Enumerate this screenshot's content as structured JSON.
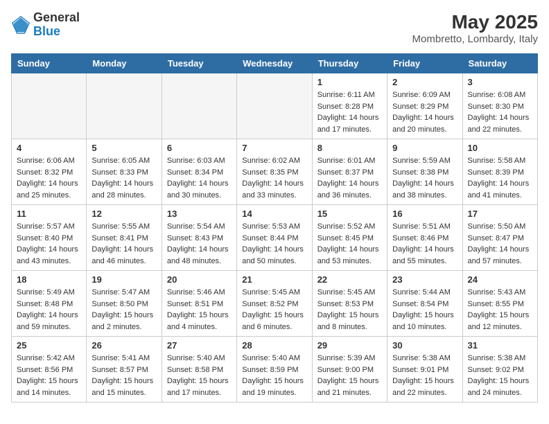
{
  "header": {
    "logo_general": "General",
    "logo_blue": "Blue",
    "month_year": "May 2025",
    "location": "Mombretto, Lombardy, Italy"
  },
  "days_of_week": [
    "Sunday",
    "Monday",
    "Tuesday",
    "Wednesday",
    "Thursday",
    "Friday",
    "Saturday"
  ],
  "weeks": [
    [
      {
        "day": "",
        "info": ""
      },
      {
        "day": "",
        "info": ""
      },
      {
        "day": "",
        "info": ""
      },
      {
        "day": "",
        "info": ""
      },
      {
        "day": "1",
        "info": "Sunrise: 6:11 AM\nSunset: 8:28 PM\nDaylight: 14 hours\nand 17 minutes."
      },
      {
        "day": "2",
        "info": "Sunrise: 6:09 AM\nSunset: 8:29 PM\nDaylight: 14 hours\nand 20 minutes."
      },
      {
        "day": "3",
        "info": "Sunrise: 6:08 AM\nSunset: 8:30 PM\nDaylight: 14 hours\nand 22 minutes."
      }
    ],
    [
      {
        "day": "4",
        "info": "Sunrise: 6:06 AM\nSunset: 8:32 PM\nDaylight: 14 hours\nand 25 minutes."
      },
      {
        "day": "5",
        "info": "Sunrise: 6:05 AM\nSunset: 8:33 PM\nDaylight: 14 hours\nand 28 minutes."
      },
      {
        "day": "6",
        "info": "Sunrise: 6:03 AM\nSunset: 8:34 PM\nDaylight: 14 hours\nand 30 minutes."
      },
      {
        "day": "7",
        "info": "Sunrise: 6:02 AM\nSunset: 8:35 PM\nDaylight: 14 hours\nand 33 minutes."
      },
      {
        "day": "8",
        "info": "Sunrise: 6:01 AM\nSunset: 8:37 PM\nDaylight: 14 hours\nand 36 minutes."
      },
      {
        "day": "9",
        "info": "Sunrise: 5:59 AM\nSunset: 8:38 PM\nDaylight: 14 hours\nand 38 minutes."
      },
      {
        "day": "10",
        "info": "Sunrise: 5:58 AM\nSunset: 8:39 PM\nDaylight: 14 hours\nand 41 minutes."
      }
    ],
    [
      {
        "day": "11",
        "info": "Sunrise: 5:57 AM\nSunset: 8:40 PM\nDaylight: 14 hours\nand 43 minutes."
      },
      {
        "day": "12",
        "info": "Sunrise: 5:55 AM\nSunset: 8:41 PM\nDaylight: 14 hours\nand 46 minutes."
      },
      {
        "day": "13",
        "info": "Sunrise: 5:54 AM\nSunset: 8:43 PM\nDaylight: 14 hours\nand 48 minutes."
      },
      {
        "day": "14",
        "info": "Sunrise: 5:53 AM\nSunset: 8:44 PM\nDaylight: 14 hours\nand 50 minutes."
      },
      {
        "day": "15",
        "info": "Sunrise: 5:52 AM\nSunset: 8:45 PM\nDaylight: 14 hours\nand 53 minutes."
      },
      {
        "day": "16",
        "info": "Sunrise: 5:51 AM\nSunset: 8:46 PM\nDaylight: 14 hours\nand 55 minutes."
      },
      {
        "day": "17",
        "info": "Sunrise: 5:50 AM\nSunset: 8:47 PM\nDaylight: 14 hours\nand 57 minutes."
      }
    ],
    [
      {
        "day": "18",
        "info": "Sunrise: 5:49 AM\nSunset: 8:48 PM\nDaylight: 14 hours\nand 59 minutes."
      },
      {
        "day": "19",
        "info": "Sunrise: 5:47 AM\nSunset: 8:50 PM\nDaylight: 15 hours\nand 2 minutes."
      },
      {
        "day": "20",
        "info": "Sunrise: 5:46 AM\nSunset: 8:51 PM\nDaylight: 15 hours\nand 4 minutes."
      },
      {
        "day": "21",
        "info": "Sunrise: 5:45 AM\nSunset: 8:52 PM\nDaylight: 15 hours\nand 6 minutes."
      },
      {
        "day": "22",
        "info": "Sunrise: 5:45 AM\nSunset: 8:53 PM\nDaylight: 15 hours\nand 8 minutes."
      },
      {
        "day": "23",
        "info": "Sunrise: 5:44 AM\nSunset: 8:54 PM\nDaylight: 15 hours\nand 10 minutes."
      },
      {
        "day": "24",
        "info": "Sunrise: 5:43 AM\nSunset: 8:55 PM\nDaylight: 15 hours\nand 12 minutes."
      }
    ],
    [
      {
        "day": "25",
        "info": "Sunrise: 5:42 AM\nSunset: 8:56 PM\nDaylight: 15 hours\nand 14 minutes."
      },
      {
        "day": "26",
        "info": "Sunrise: 5:41 AM\nSunset: 8:57 PM\nDaylight: 15 hours\nand 15 minutes."
      },
      {
        "day": "27",
        "info": "Sunrise: 5:40 AM\nSunset: 8:58 PM\nDaylight: 15 hours\nand 17 minutes."
      },
      {
        "day": "28",
        "info": "Sunrise: 5:40 AM\nSunset: 8:59 PM\nDaylight: 15 hours\nand 19 minutes."
      },
      {
        "day": "29",
        "info": "Sunrise: 5:39 AM\nSunset: 9:00 PM\nDaylight: 15 hours\nand 21 minutes."
      },
      {
        "day": "30",
        "info": "Sunrise: 5:38 AM\nSunset: 9:01 PM\nDaylight: 15 hours\nand 22 minutes."
      },
      {
        "day": "31",
        "info": "Sunrise: 5:38 AM\nSunset: 9:02 PM\nDaylight: 15 hours\nand 24 minutes."
      }
    ]
  ]
}
